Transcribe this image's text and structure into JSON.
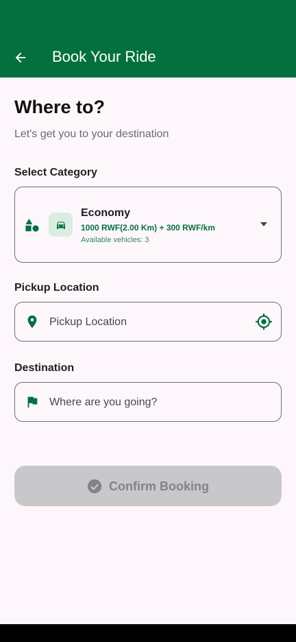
{
  "app_bar": {
    "title": "Book Your Ride",
    "background_color": "#05703f",
    "back_icon": "arrow-back-icon"
  },
  "page": {
    "heading": "Where to?",
    "subheading": "Let's get you to your destination"
  },
  "category": {
    "label": "Select Category",
    "selected": {
      "name": "Economy",
      "price": "1000 RWF(2.00 Km) + 300 RWF/km",
      "availability": "Available vehicles: 3"
    },
    "icons": [
      "shapes-icon",
      "car-icon",
      "dropdown-caret-icon"
    ]
  },
  "pickup": {
    "label": "Pickup Location",
    "placeholder": "Pickup Location",
    "value": "",
    "icons": [
      "location-pin-icon",
      "my-location-icon"
    ]
  },
  "destination": {
    "label": "Destination",
    "placeholder": "Where are you going?",
    "value": "",
    "icons": [
      "flag-icon"
    ]
  },
  "confirm_button": {
    "label": "Confirm Booking",
    "enabled": false,
    "icon": "check-circle-icon"
  },
  "colors": {
    "primary": "#05703f",
    "background": "#fdf7fb",
    "disabled_button": "#c8c7c9",
    "disabled_text": "#858287"
  }
}
